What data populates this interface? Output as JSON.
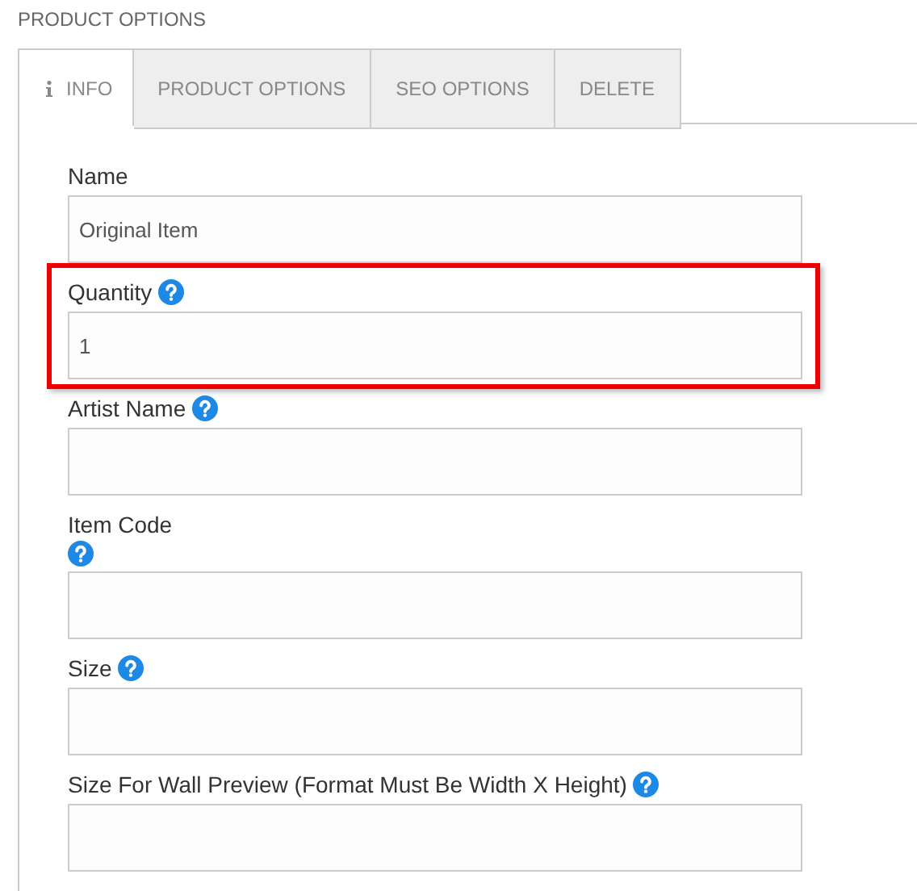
{
  "heading": "PRODUCT OPTIONS",
  "tabs": [
    {
      "label": "INFO",
      "selected": true
    },
    {
      "label": "PRODUCT OPTIONS",
      "selected": false
    },
    {
      "label": "SEO OPTIONS",
      "selected": false
    },
    {
      "label": "DELETE",
      "selected": false
    }
  ],
  "fields": [
    {
      "label": "Name",
      "value": "Original Item",
      "kind": "plain",
      "highlighted": false
    },
    {
      "label": "Quantity",
      "value": "1",
      "kind": "help",
      "highlighted": true
    },
    {
      "label": "Artist Name",
      "kind": "help",
      "highlighted": false
    },
    {
      "label": "Item Code",
      "kind": "helpbelow",
      "highlighted": false
    },
    {
      "label": "Size",
      "kind": "help",
      "highlighted": false
    },
    {
      "label": "Size For Wall Preview (Format Must Be Width X Height)",
      "kind": "help",
      "highlighted": false
    }
  ]
}
